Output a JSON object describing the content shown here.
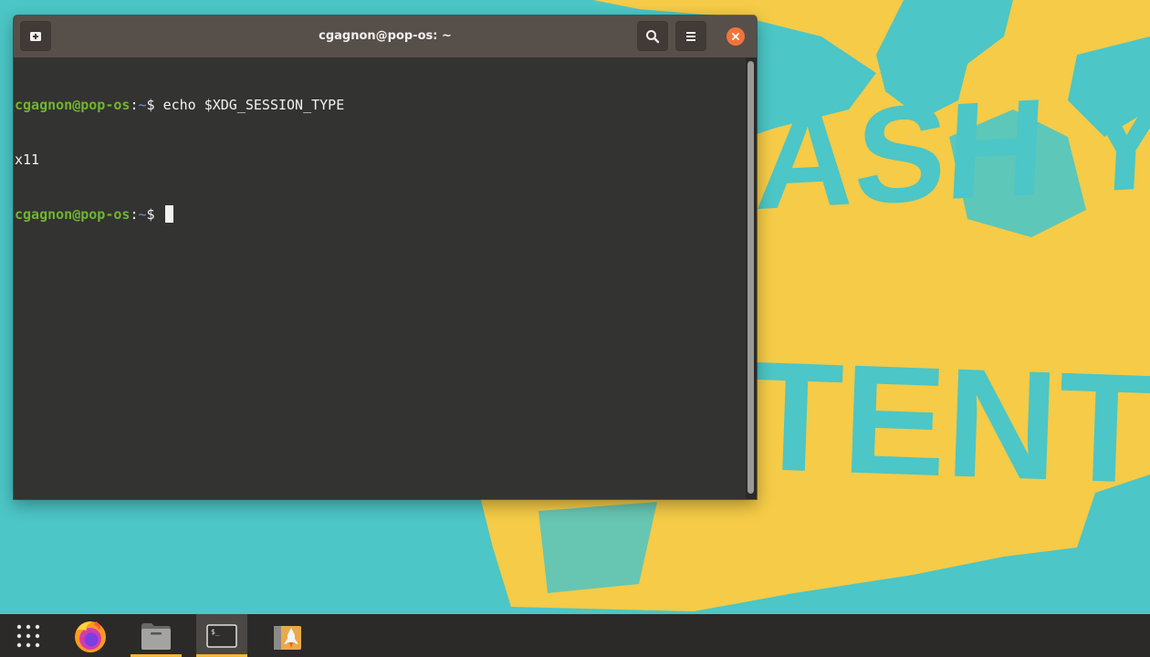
{
  "terminal": {
    "title": "cgagnon@pop-os: ~",
    "lines": [
      {
        "user": "cgagnon@pop-os",
        "sep": ":",
        "path": "~",
        "prompt": "$ ",
        "command": "echo $XDG_SESSION_TYPE"
      },
      {
        "output": "x11"
      },
      {
        "user": "cgagnon@pop-os",
        "sep": ":",
        "path": "~",
        "prompt": "$ ",
        "command": ""
      }
    ]
  },
  "colors": {
    "desktop": "#4cc6c6",
    "wallpaper_art": "#f5cb47",
    "titlebar": "#574f4a",
    "terminal_bg": "#333331",
    "prompt_user": "#6fb52d",
    "prompt_path": "#5b9bd5",
    "close_button": "#f0753b",
    "dock": "#2b2a28",
    "running_indicator": "#f7b731"
  },
  "wallpaper": {
    "poster_text": [
      "ASH YO",
      "TENTI"
    ]
  },
  "dock": {
    "items": [
      {
        "name": "app-grid",
        "icon": "grid-dots-icon"
      },
      {
        "name": "firefox",
        "icon": "firefox-icon"
      },
      {
        "name": "files",
        "icon": "folder-icon",
        "running": true
      },
      {
        "name": "terminal",
        "icon": "terminal-icon",
        "running": true,
        "active": true
      },
      {
        "name": "popshop",
        "icon": "rocket-icon"
      }
    ]
  }
}
